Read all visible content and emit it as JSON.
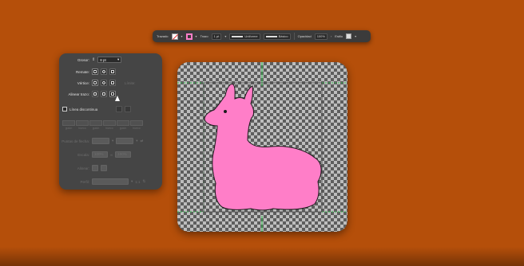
{
  "control_bar": {
    "object_label": "Trazado",
    "stroke_label": "Trazo",
    "width_value": "1 pt",
    "profile_label": "Uniforme",
    "brush_label": "Básico",
    "opacity_label": "Opacidad",
    "opacity_value": "100%",
    "style_label": "Estilo"
  },
  "stroke_panel": {
    "weight_label": "Grosor:",
    "weight_value": "8 pt",
    "cap_label": "Remate:",
    "corner_label": "Vértice:",
    "limit_label": "Límite:",
    "align_label": "Alinear trazo:",
    "dashed_label": "Línea discontinua",
    "dash_labels": [
      "guión",
      "hueco",
      "guión",
      "hueco",
      "guión",
      "hueco"
    ],
    "arrow_label": "Puntas de flecha:",
    "scale_label": "Escala:",
    "scale_values": [
      "100%",
      "100%"
    ],
    "align_arrow_label": "Alinear:",
    "profile_label": "Perfil:",
    "profile_value": "1:1"
  },
  "colors": {
    "background": "#b54f0a",
    "llama_fill": "#ff7ec8",
    "guide": "#2fbf4a"
  }
}
